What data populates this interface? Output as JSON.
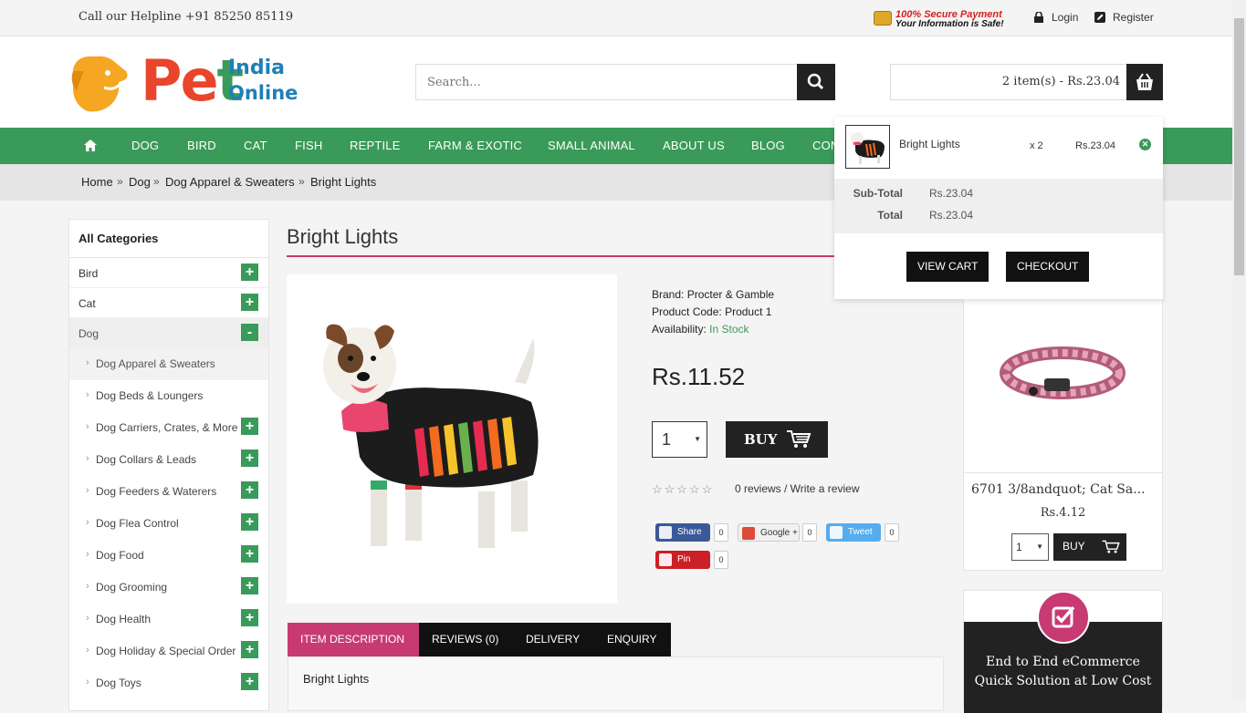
{
  "topbar": {
    "helpline": "Call our Helpline +91 85250 85119",
    "secure_line1": "100% Secure Payment",
    "secure_line2": "Your Information is Safe!",
    "login": "Login",
    "register": "Register"
  },
  "logo": {
    "pet": "Pet",
    "india": "India",
    "online": "Online"
  },
  "search": {
    "placeholder": "Search..."
  },
  "cart": {
    "summary": "2 item(s) - Rs.23.04"
  },
  "nav": {
    "items": [
      "DOG",
      "BIRD",
      "CAT",
      "FISH",
      "REPTILE",
      "FARM & EXOTIC",
      "SMALL ANIMAL",
      "ABOUT US",
      "BLOG",
      "CON"
    ]
  },
  "breadcrumb": {
    "items": [
      "Home",
      "Dog",
      "Dog Apparel & Sweaters",
      "Bright Lights"
    ],
    "sep": "»"
  },
  "sidebar": {
    "title": "All Categories",
    "categories": [
      "Bird",
      "Cat",
      "Dog"
    ],
    "subcategories": [
      "Dog Apparel & Sweaters",
      "Dog Beds & Loungers",
      "Dog Carriers, Crates, & More",
      "Dog Collars & Leads",
      "Dog Feeders & Waterers",
      "Dog Flea Control",
      "Dog Food",
      "Dog Grooming",
      "Dog Health",
      "Dog Holiday & Special Order",
      "Dog Toys"
    ],
    "plus": "+",
    "minus": "-"
  },
  "product": {
    "title": "Bright Lights",
    "brand_label": "Brand:",
    "brand": "Procter & Gamble",
    "code_label": "Product Code:",
    "code": "Product 1",
    "availability_label": "Availability:",
    "availability": "In Stock",
    "price": "Rs.11.52",
    "qty": "1",
    "buy": "BUY",
    "stars": "☆☆☆☆☆",
    "reviews": "0 reviews / Write a review",
    "rating": 0
  },
  "social": {
    "share": "Share",
    "share_count": "0",
    "google": "Google +",
    "google_count": "0",
    "tweet": "Tweet",
    "tweet_count": "0",
    "pin": "Pin",
    "pin_count": "0"
  },
  "tabs": {
    "items": [
      "ITEM DESCRIPTION",
      "REVIEWS (0)",
      "DELIVERY",
      "ENQUIRY"
    ],
    "content": "Bright Lights"
  },
  "related": {
    "name": "6701 3/8andquot; Cat Sa...",
    "price": "Rs.4.12",
    "qty": "1",
    "buy": "BUY"
  },
  "promo": {
    "line1": "End to End eCommerce",
    "line2": "Quick Solution at Low Cost"
  },
  "cart_dropdown": {
    "item_name": "Bright Lights",
    "item_qty": "x 2",
    "item_price": "Rs.23.04",
    "subtotal_label": "Sub-Total",
    "subtotal": "Rs.23.04",
    "total_label": "Total",
    "total": "Rs.23.04",
    "view_cart": "VIEW CART",
    "checkout": "CHECKOUT"
  },
  "colors": {
    "green": "#3a9a59",
    "magenta": "#c73a72",
    "dark": "#222222",
    "logo_orange": "#f5a623",
    "logo_red": "#e8452c",
    "logo_blue": "#1f7fb6"
  },
  "icons": [
    "lock-icon",
    "edit-icon",
    "search-icon",
    "basket-icon",
    "home-icon",
    "cart-icon",
    "remove-icon",
    "checkbox-icon"
  ]
}
